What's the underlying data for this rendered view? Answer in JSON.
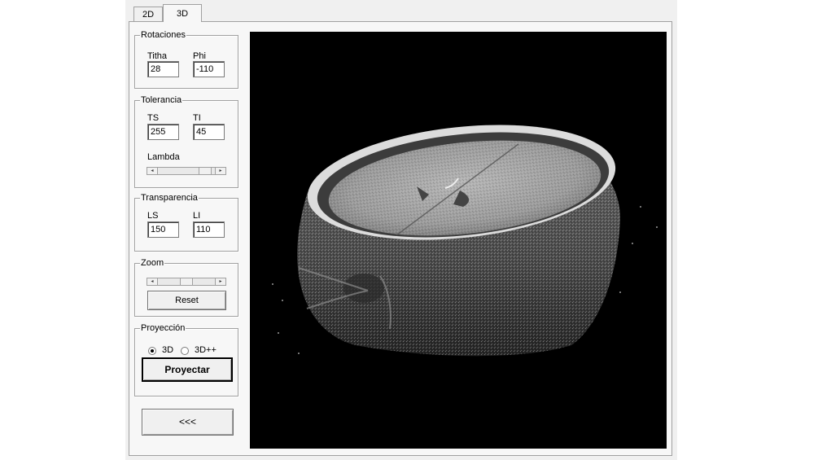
{
  "tabs": [
    {
      "label": "2D",
      "active": false
    },
    {
      "label": "3D",
      "active": true
    }
  ],
  "rotaciones": {
    "title": "Rotaciones",
    "titha_label": "Titha",
    "titha_value": "28",
    "phi_label": "Phi",
    "phi_value": "-110"
  },
  "tolerancia": {
    "title": "Tolerancia",
    "ts_label": "TS",
    "ts_value": "255",
    "ti_label": "TI",
    "ti_value": "45",
    "lambda_label": "Lambda"
  },
  "transparencia": {
    "title": "Transparencia",
    "ls_label": "LS",
    "ls_value": "150",
    "li_label": "LI",
    "li_value": "110"
  },
  "zoom": {
    "title": "Zoom",
    "reset_label": "Reset"
  },
  "proyeccion": {
    "title": "Proyección",
    "option_3d": "3D",
    "option_3dpp": "3D++",
    "selected": "3D",
    "button_label": "Proyectar"
  },
  "back_button_label": "<<<",
  "colors": {
    "window_bg": "#f0f0f0",
    "viewport_bg": "#000000"
  }
}
